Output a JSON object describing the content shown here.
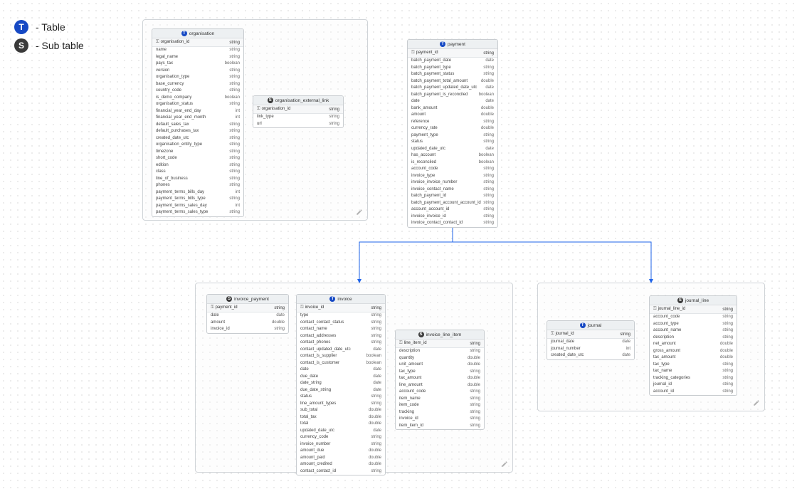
{
  "legend": {
    "table": {
      "letter": "T",
      "label": "- Table"
    },
    "sub": {
      "letter": "S",
      "label": "- Sub table"
    }
  },
  "entities": {
    "organisation": {
      "kind": "T",
      "title": "organisation",
      "pk": "organisation_id",
      "pk_type": "string",
      "fields": [
        [
          "name",
          "string"
        ],
        [
          "legal_name",
          "string"
        ],
        [
          "pays_tax",
          "boolean"
        ],
        [
          "version",
          "string"
        ],
        [
          "organisation_type",
          "string"
        ],
        [
          "base_currency",
          "string"
        ],
        [
          "country_code",
          "string"
        ],
        [
          "is_demo_company",
          "boolean"
        ],
        [
          "organisation_status",
          "string"
        ],
        [
          "financial_year_end_day",
          "int"
        ],
        [
          "financial_year_end_month",
          "int"
        ],
        [
          "default_sales_tax",
          "string"
        ],
        [
          "default_purchases_tax",
          "string"
        ],
        [
          "created_date_utc",
          "string"
        ],
        [
          "organisation_entity_type",
          "string"
        ],
        [
          "timezone",
          "string"
        ],
        [
          "short_code",
          "string"
        ],
        [
          "edition",
          "string"
        ],
        [
          "class",
          "string"
        ],
        [
          "line_of_business",
          "string"
        ],
        [
          "phones",
          "string"
        ],
        [
          "payment_terms_bills_day",
          "int"
        ],
        [
          "payment_terms_bills_type",
          "string"
        ],
        [
          "payment_terms_sales_day",
          "int"
        ],
        [
          "payment_terms_sales_type",
          "string"
        ]
      ]
    },
    "organisation_external_link": {
      "kind": "S",
      "title": "organisation_external_link",
      "pk": "organisation_id",
      "pk_type": "string",
      "fields": [
        [
          "link_type",
          "string"
        ],
        [
          "url",
          "string"
        ]
      ]
    },
    "payment": {
      "kind": "T",
      "title": "payment",
      "pk": "payment_id",
      "pk_type": "string",
      "fields": [
        [
          "batch_payment_date",
          "date"
        ],
        [
          "batch_payment_type",
          "string"
        ],
        [
          "batch_payment_status",
          "string"
        ],
        [
          "batch_payment_total_amount",
          "double"
        ],
        [
          "batch_payment_updated_date_utc",
          "date"
        ],
        [
          "batch_payment_is_reconciled",
          "boolean"
        ],
        [
          "date",
          "date"
        ],
        [
          "bank_amount",
          "double"
        ],
        [
          "amount",
          "double"
        ],
        [
          "reference",
          "string"
        ],
        [
          "currency_rate",
          "double"
        ],
        [
          "payment_type",
          "string"
        ],
        [
          "status",
          "string"
        ],
        [
          "updated_date_utc",
          "date"
        ],
        [
          "has_account",
          "boolean"
        ],
        [
          "is_reconciled",
          "boolean"
        ],
        [
          "account_code",
          "string"
        ],
        [
          "invoice_type",
          "string"
        ],
        [
          "invoice_invoice_number",
          "string"
        ],
        [
          "invoice_contact_name",
          "string"
        ],
        [
          "batch_payment_id",
          "string"
        ],
        [
          "batch_payment_account_account_id",
          "string"
        ],
        [
          "account_account_id",
          "string"
        ],
        [
          "invoice_invoice_id",
          "string"
        ],
        [
          "invoice_contact_contact_id",
          "string"
        ]
      ]
    },
    "invoice_payment": {
      "kind": "S",
      "title": "invoice_payment",
      "pk": "payment_id",
      "pk_type": "string",
      "fields": [
        [
          "date",
          "date"
        ],
        [
          "amount",
          "double"
        ],
        [
          "invoice_id",
          "string"
        ]
      ]
    },
    "invoice": {
      "kind": "T",
      "title": "invoice",
      "pk": "invoice_id",
      "pk_type": "string",
      "fields": [
        [
          "type",
          "string"
        ],
        [
          "contact_contact_status",
          "string"
        ],
        [
          "contact_name",
          "string"
        ],
        [
          "contact_addresses",
          "string"
        ],
        [
          "contact_phones",
          "string"
        ],
        [
          "contact_updated_date_utc",
          "date"
        ],
        [
          "contact_is_supplier",
          "boolean"
        ],
        [
          "contact_is_customer",
          "boolean"
        ],
        [
          "date",
          "date"
        ],
        [
          "due_date",
          "date"
        ],
        [
          "date_string",
          "date"
        ],
        [
          "due_date_string",
          "date"
        ],
        [
          "status",
          "string"
        ],
        [
          "line_amount_types",
          "string"
        ],
        [
          "sub_total",
          "double"
        ],
        [
          "total_tax",
          "double"
        ],
        [
          "total",
          "double"
        ],
        [
          "updated_date_utc",
          "date"
        ],
        [
          "currency_code",
          "string"
        ],
        [
          "invoice_number",
          "string"
        ],
        [
          "amount_due",
          "double"
        ],
        [
          "amount_paid",
          "double"
        ],
        [
          "amount_credited",
          "double"
        ],
        [
          "contact_contact_id",
          "string"
        ]
      ]
    },
    "invoice_line_item": {
      "kind": "S",
      "title": "invoice_line_item",
      "pk": "line_item_id",
      "pk_type": "string",
      "fields": [
        [
          "description",
          "string"
        ],
        [
          "quantity",
          "double"
        ],
        [
          "unit_amount",
          "double"
        ],
        [
          "tax_type",
          "string"
        ],
        [
          "tax_amount",
          "double"
        ],
        [
          "line_amount",
          "double"
        ],
        [
          "account_code",
          "string"
        ],
        [
          "item_name",
          "string"
        ],
        [
          "item_code",
          "string"
        ],
        [
          "tracking",
          "string"
        ],
        [
          "invoice_id",
          "string"
        ],
        [
          "item_item_id",
          "string"
        ]
      ]
    },
    "journal": {
      "kind": "T",
      "title": "journal",
      "pk": "journal_id",
      "pk_type": "string",
      "fields": [
        [
          "journal_date",
          "date"
        ],
        [
          "journal_number",
          "int"
        ],
        [
          "created_date_utc",
          "date"
        ]
      ]
    },
    "journal_line": {
      "kind": "S",
      "title": "journal_line",
      "pk": "journal_line_id",
      "pk_type": "string",
      "fields": [
        [
          "account_code",
          "string"
        ],
        [
          "account_type",
          "string"
        ],
        [
          "account_name",
          "string"
        ],
        [
          "description",
          "string"
        ],
        [
          "net_amount",
          "double"
        ],
        [
          "gross_amount",
          "double"
        ],
        [
          "tax_amount",
          "double"
        ],
        [
          "tax_type",
          "string"
        ],
        [
          "tax_name",
          "string"
        ],
        [
          "tracking_categories",
          "string"
        ],
        [
          "journal_id",
          "string"
        ],
        [
          "account_id",
          "string"
        ]
      ]
    }
  }
}
